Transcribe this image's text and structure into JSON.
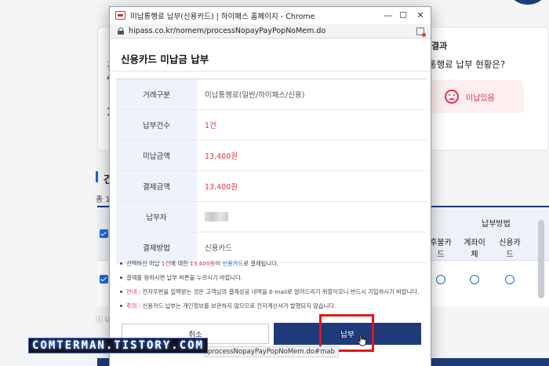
{
  "background": {
    "left_lines": [
      "김",
      "4"
    ],
    "left_number": "1",
    "result_title": "결과",
    "result_question": "통행료 납부 현황은?",
    "status_text": "미납있음",
    "section_title": "건",
    "count_text": "총 1건",
    "pay_method_header": "납부방법",
    "columns": [
      "후불카드",
      "계좌이체",
      "신용카드"
    ],
    "info_text": "ⓘ 내"
  },
  "window": {
    "title": "미납통행료 납부(신용카드) | 하이패스 홈페이지 - Chrome",
    "url": "hipass.co.kr/nomem/processNopayPayPopNoMem.do",
    "minimize": "—",
    "maximize": "☐",
    "close": "✕"
  },
  "popup": {
    "title": "신용카드 미납금 납부",
    "rows": [
      {
        "label": "거래구분",
        "value": "미납통행료(일반/하이패스/신용)",
        "red": false
      },
      {
        "label": "납부건수",
        "value": "1건",
        "red": true
      },
      {
        "label": "미납금액",
        "value": "13,400원",
        "red": true
      },
      {
        "label": "결제금액",
        "value": "13,400원",
        "red": true
      },
      {
        "label": "납부자",
        "value": "",
        "red": false
      },
      {
        "label": "결제방법",
        "value": "신용카드",
        "red": false
      }
    ],
    "notes": {
      "n1_a": "선택하신 미납 ",
      "n1_b": "1건",
      "n1_c": "에 대한 ",
      "n1_d": "13,400원",
      "n1_e": "이 ",
      "n1_f": "신용카드",
      "n1_g": "로 결제됩니다.",
      "n2": "결제를 원하시면 납부 버튼을 누르시기 바랍니다.",
      "n3_label": "안내",
      "n3_text": " : 전자우편을 입력받는 것은 고객님의 결제성공 내역을 E-mail로 알려드리기 위함이오니 반드시 기입하시기 바랍니다.",
      "n4_label": "주의",
      "n4_text": " : 신용카드 납부는 개인정보를 보관하지 않으므로 전자계산서가 발행되지 않습니다."
    },
    "cancel_label": "취소",
    "pay_label": "납부",
    "status_url": "processNopayPayPopNoMem.do#mab"
  },
  "watermark": "COMTERMAN.TISTORY.COM",
  "colors": {
    "navy": "#1f3a78",
    "red": "#e0344c",
    "blue": "#1f6ad8",
    "highlight": "#e01818"
  }
}
